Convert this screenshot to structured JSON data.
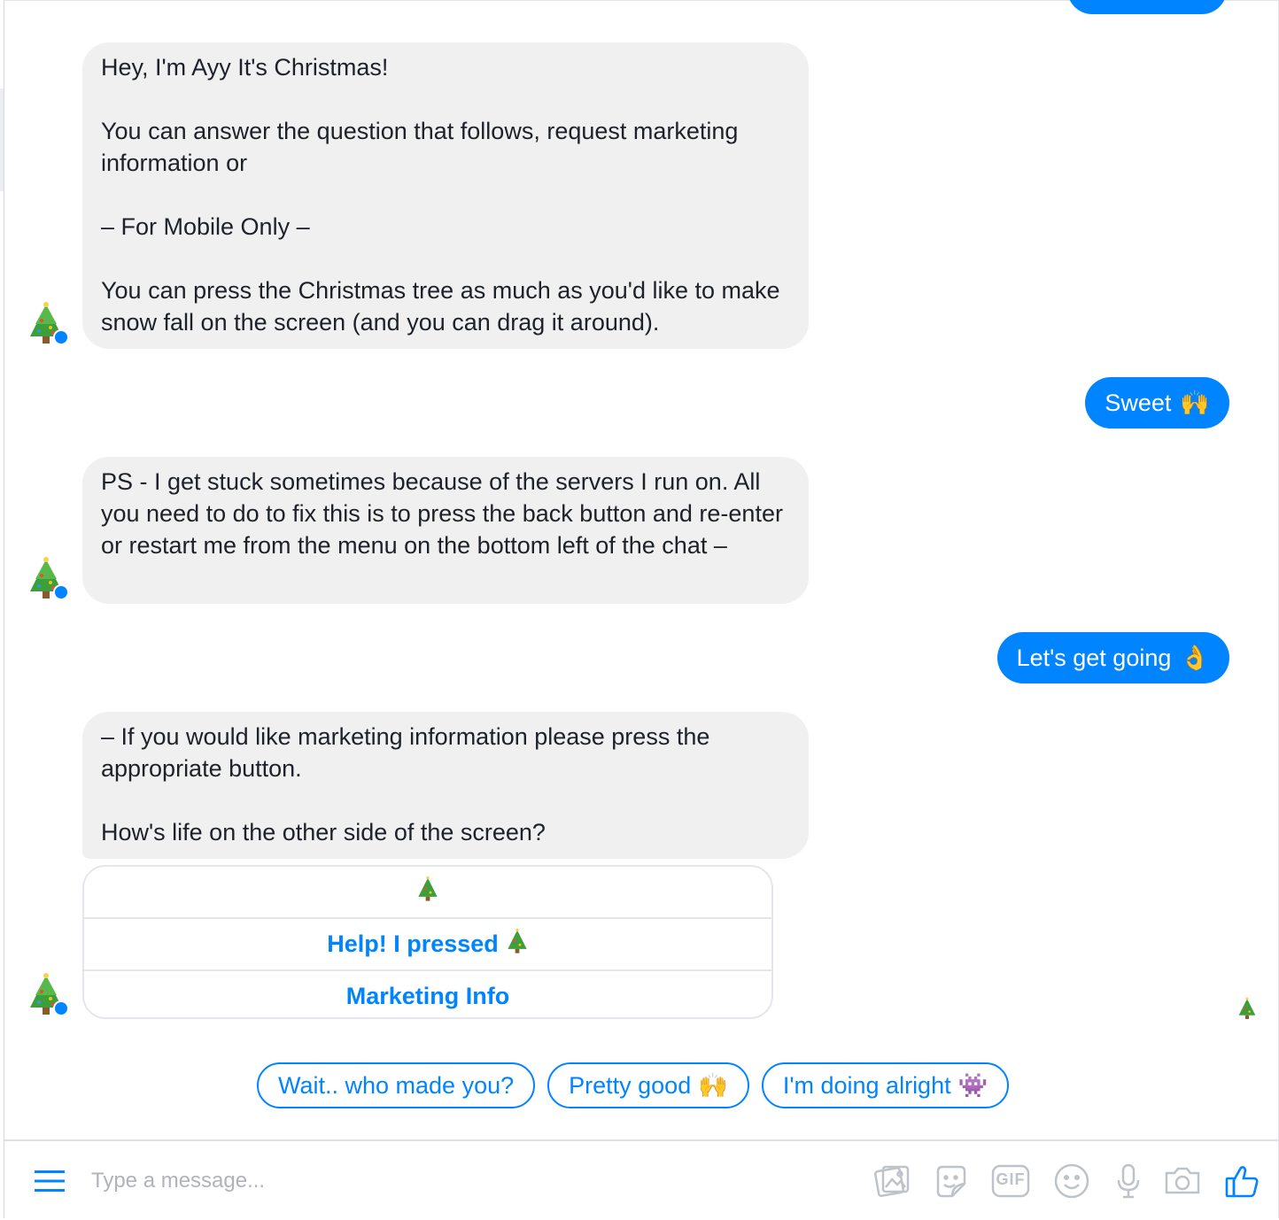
{
  "conversation": {
    "messages": [
      {
        "from": "bot",
        "text": "Hey, I'm Ayy It's Christmas!\n\nYou can answer the question that follows, request marketing information or\n\n– For Mobile Only –\n\nYou can press the Christmas tree as much as you'd like to make snow fall on the screen (and you can drag it around)."
      },
      {
        "from": "user",
        "text": "Sweet",
        "emoji": "🙌"
      },
      {
        "from": "bot",
        "text": "PS - I get stuck sometimes because of the servers I run on. All you need to do to fix this is to press the back button and re-enter or restart me from the menu on the bottom left of the chat –"
      },
      {
        "from": "user",
        "text": "Let's get going",
        "emoji": "👌"
      },
      {
        "from": "bot",
        "text": "– If you would like marketing information please press the appropriate button.\n\nHow's life on the other side of the screen?"
      }
    ],
    "button_card": {
      "header_icon": "christmas-tree-icon",
      "buttons": [
        {
          "label": "Help! I pressed",
          "icon": "christmas-tree-icon"
        },
        {
          "label": "Marketing Info"
        }
      ]
    },
    "bot_avatar_icon": "christmas-tree-icon",
    "seen_indicator_icon": "christmas-tree-icon"
  },
  "quick_replies": [
    {
      "label": "Wait.. who made you?"
    },
    {
      "label": "Pretty good",
      "emoji": "🙌"
    },
    {
      "label": "I'm doing alright",
      "emoji": "👾"
    }
  ],
  "composer": {
    "placeholder": "Type a message...",
    "gif_label": "GIF",
    "tools": [
      "image-icon",
      "sticker-icon",
      "gif-icon",
      "emoji-icon",
      "microphone-icon",
      "camera-icon",
      "thumbs-up-icon"
    ]
  },
  "colors": {
    "accent": "#0084ff",
    "bot_bubble": "#f1f0f0",
    "text": "#1d2129",
    "placeholder": "#b0b3b8",
    "icon_gray": "#bec2c9"
  }
}
